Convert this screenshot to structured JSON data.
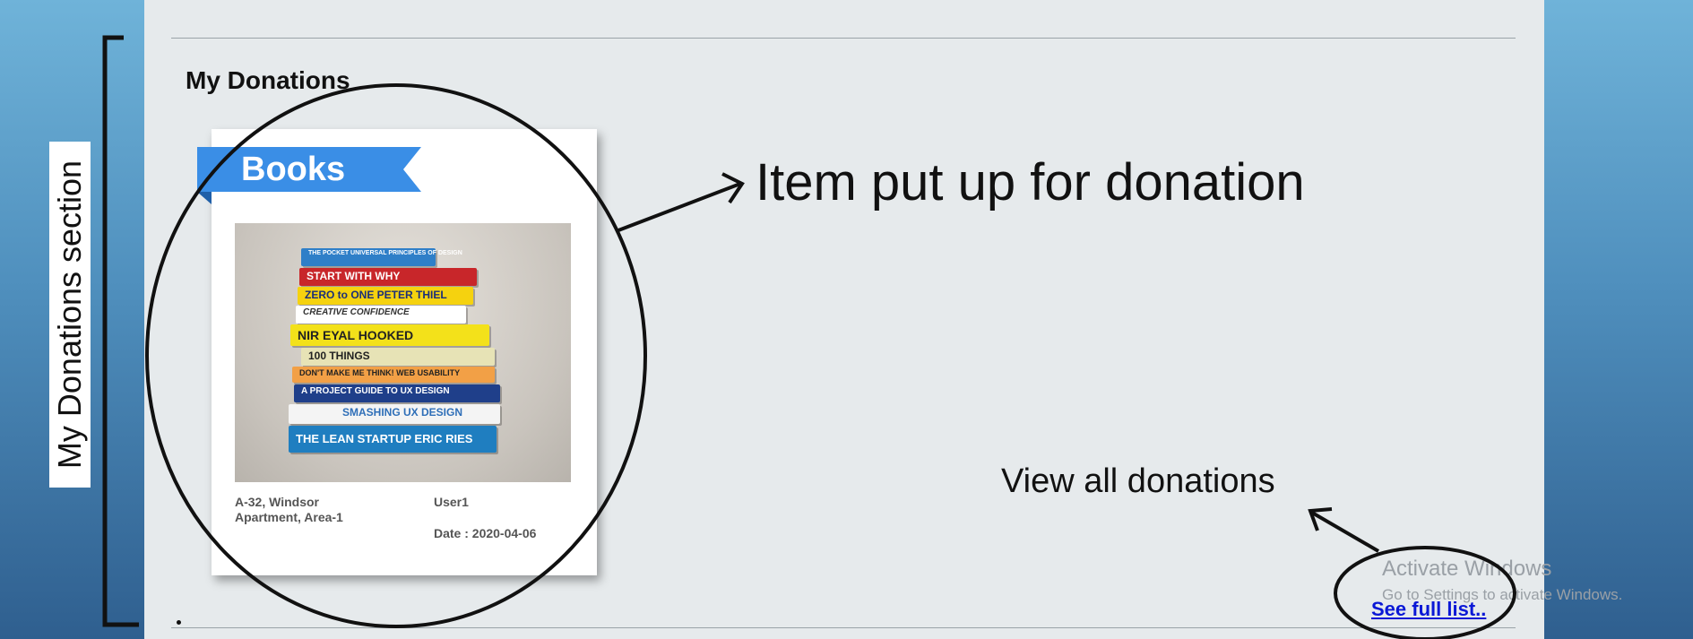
{
  "section": {
    "title": "My Donations"
  },
  "card": {
    "category": "Books",
    "address": "A-32, Windsor Apartment, Area-1",
    "user": "User1",
    "date": "Date : 2020-04-06"
  },
  "books": [
    "THE POCKET UNIVERSAL PRINCIPLES OF DESIGN",
    "START WITH WHY",
    "ZERO to ONE   PETER THIEL",
    "CREATIVE CONFIDENCE",
    "NIR EYAL  HOOKED",
    "100 THINGS",
    "DON'T MAKE ME THINK!  WEB USABILITY",
    "A PROJECT GUIDE TO UX DESIGN",
    "SMASHING UX DESIGN",
    "THE LEAN STARTUP  ERIC RIES"
  ],
  "links": {
    "see_full_list": "See full list.."
  },
  "annotations": {
    "item": "Item put up for donation",
    "view_all": "View all donations",
    "section_label": "My Donations section"
  },
  "watermark": {
    "line1": "Activate Windows",
    "line2": "Go to Settings to activate Windows."
  },
  "colors": {
    "ribbon": "#3a8ee6",
    "link": "#0a18d6",
    "panel": "#e6eaec"
  }
}
